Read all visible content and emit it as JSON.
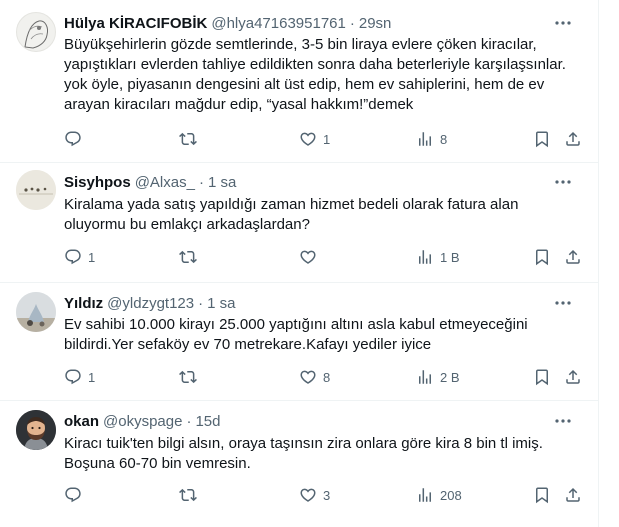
{
  "tweets": [
    {
      "name": "Hülya KİRACIFOBİK",
      "handle": "@hlya47163951761",
      "separator": "·",
      "time": "29sn",
      "text": "Büyükşehirlerin gözde semtlerinde, 3-5 bin liraya evlere çöken kiracılar, yapıştıkları evlerden tahliye edildikten sonra daha beterleriyle karşılaşsınlar. yok öyle, piyasanın dengesini alt üst edip, hem ev sahiplerini, hem de ev arayan kiracıları mağdur edip, “yasal hakkım!”demek",
      "replies": "",
      "retweets": "",
      "likes": "1",
      "views": "8"
    },
    {
      "name": "Sisyhpos",
      "handle": "@Alxas_",
      "separator": "·",
      "time": "1 sa",
      "text": "Kiralama yada satış yapıldığı zaman hizmet bedeli olarak fatura alan oluyormu bu emlakçı arkadaşlardan?",
      "replies": "1",
      "retweets": "",
      "likes": "",
      "views": "1 B"
    },
    {
      "name": "Yıldız",
      "handle": "@yldzygt123",
      "separator": "·",
      "time": "1 sa",
      "text": "Ev sahibi 10.000 kirayı 25.000 yaptığını altını asla kabul etmeyeceğini bildirdi.Yer sefaköy ev 70 metrekare.Kafayı yediler iyice",
      "replies": "1",
      "retweets": "",
      "likes": "8",
      "views": "2 B"
    },
    {
      "name": "okan",
      "handle": "@okyspage",
      "separator": "·",
      "time": "15d",
      "text": "Kiracı tuik'ten bilgi alsın, oraya taşınsın zira onlara göre kira 8 bin tl imiş. Boşuna 60-70 bin vemresin.",
      "replies": "",
      "retweets": "",
      "likes": "3",
      "views": "208"
    }
  ],
  "icons": {
    "more": "more-icon",
    "reply": "reply-icon",
    "retweet": "retweet-icon",
    "like": "heart-icon",
    "views": "views-icon",
    "bookmark": "bookmark-icon",
    "share": "share-icon"
  },
  "colors": {
    "text": "#0f1419",
    "secondary": "#536471",
    "divider": "#eff3f4"
  }
}
